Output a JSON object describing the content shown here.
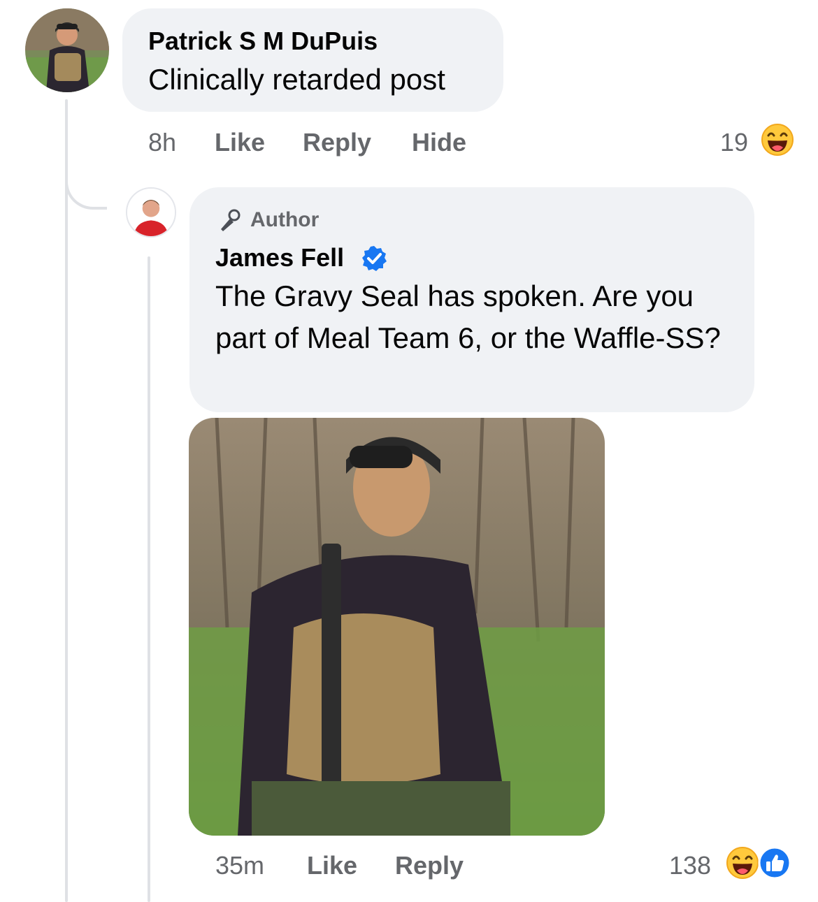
{
  "comment": {
    "author": "Patrick S M DuPuis",
    "text": "Clinically retarded post",
    "time": "8h",
    "like_label": "Like",
    "reply_label": "Reply",
    "hide_label": "Hide",
    "reaction_count": "19",
    "reaction_icon": "haha-icon"
  },
  "reply": {
    "badge": "Author",
    "badge_icon": "microphone-icon",
    "author": "James Fell",
    "verified_icon": "verified-badge-icon",
    "text": "The Gravy Seal has spoken. Are you part of Meal Team 6, or the Waffle-SS?",
    "time": "35m",
    "like_label": "Like",
    "reply_label": "Reply",
    "reaction_count": "138",
    "reaction_icons": [
      "haha-icon",
      "like-icon"
    ]
  },
  "colors": {
    "bubble": "#f0f2f5",
    "meta_text": "#65676b",
    "verified_blue": "#1877f2",
    "haha_yellow": "#ffc93c"
  }
}
